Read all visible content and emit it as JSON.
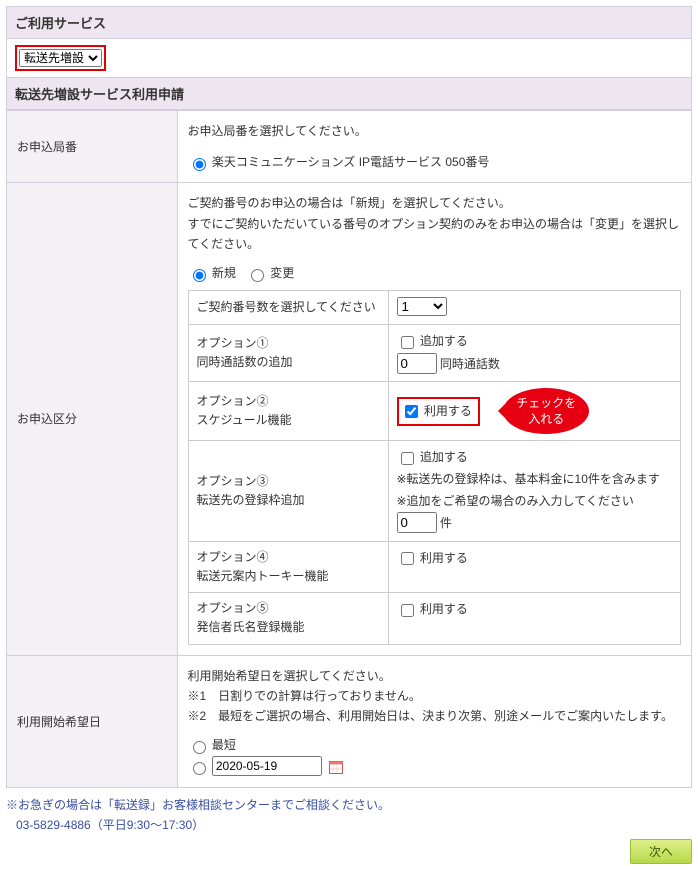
{
  "topHeader": "ご利用サービス",
  "serviceSelect": "転送先増設",
  "formHeader": "転送先増設サービス利用申請",
  "row1": {
    "label": "お申込局番",
    "lead": "お申込局番を選択してください。",
    "radio1": "楽天コミュニケーションズ IP電話サービス  050番号"
  },
  "row2": {
    "label": "お申込区分",
    "lead1": "ご契約番号のお申込の場合は「新規」を選択してください。",
    "lead2": "すでにご契約いただいている番号のオプション契約のみをお申込の場合は「変更」を選択してください。",
    "radioNew": "新規",
    "radioChange": "変更",
    "qtyLabel": "ご契約番号数を選択してください",
    "qtyValue": "1",
    "opt1": {
      "title": "オプション①",
      "sub": "同時通話数の追加",
      "chkAdd": "追加する",
      "numLabel": "同時通話数",
      "numVal": "0"
    },
    "opt2": {
      "title": "オプション②",
      "sub": "スケジュール機能",
      "chkUse": "利用する"
    },
    "bubble": {
      "l1": "チェックを",
      "l2": "入れる"
    },
    "opt3": {
      "title": "オプション③",
      "sub": "転送先の登録枠追加",
      "chkAdd": "追加する",
      "note1": "※転送先の登録枠は、基本料金に10件を含みます",
      "note2": "※追加をご希望の場合のみ入力してください",
      "unit": "件",
      "numVal": "0"
    },
    "opt4": {
      "title": "オプション④",
      "sub": "転送元案内トーキー機能",
      "chkUse": "利用する"
    },
    "opt5": {
      "title": "オプション⑤",
      "sub": "発信者氏名登録機能",
      "chkUse": "利用する"
    }
  },
  "row3": {
    "label": "利用開始希望日",
    "lead": "利用開始希望日を選択してください。",
    "note1": "※1　日割りでの計算は行っておりません。",
    "note2": "※2　最短をご選択の場合、利用開始日は、決まり次第、別途メールでご案内いたします。",
    "radioFast": "最短",
    "dateVal": "2020-05-19"
  },
  "footerNote": "※お急ぎの場合は「転送録」お客様相談センターまでご相談ください。",
  "footerPhone": "03-5829-4886（平日9:30～17:30）",
  "nextBtn": "次へ"
}
